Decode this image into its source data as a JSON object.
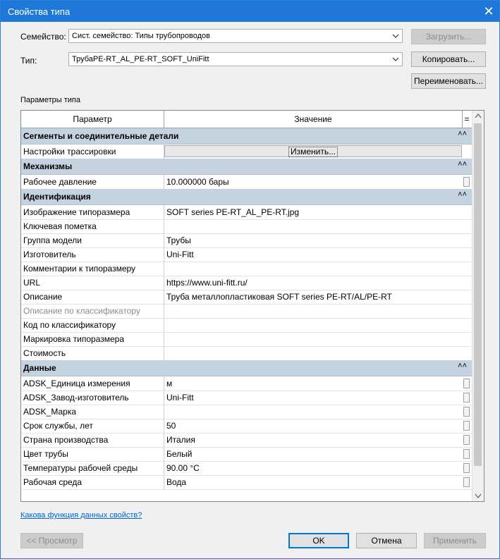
{
  "window": {
    "title": "Свойства типа"
  },
  "family": {
    "label": "Семейство:",
    "value": "Сист. семейство: Типы трубопроводов"
  },
  "type": {
    "label": "Тип:",
    "value": "ТрубаPE-RT_AL_PE-RT_SOFT_UniFitt"
  },
  "buttons": {
    "load": "Загрузить...",
    "copy": "Копировать...",
    "rename": "Переименовать...",
    "preview": "<< Просмотр",
    "ok": "OK",
    "cancel": "Отмена",
    "apply": "Применить"
  },
  "section_label": "Параметры типа",
  "grid": {
    "col_param": "Параметр",
    "col_value": "Значение",
    "col_extra": "=",
    "edit_button": "Изменить...",
    "groups": [
      {
        "title": "Сегменты и соединительные детали",
        "rows": [
          {
            "param": "Настройки трассировки",
            "value": ""
          }
        ]
      },
      {
        "title": "Механизмы",
        "rows": [
          {
            "param": "Рабочее давление",
            "value": "10.000000 бары"
          }
        ]
      },
      {
        "title": "Идентификация",
        "rows": [
          {
            "param": "Изображение типоразмера",
            "value": "SOFT series PE-RT_AL_PE-RT.jpg"
          },
          {
            "param": "Ключевая пометка",
            "value": ""
          },
          {
            "param": "Группа модели",
            "value": "Трубы"
          },
          {
            "param": "Изготовитель",
            "value": "Uni-Fitt"
          },
          {
            "param": "Комментарии к типоразмеру",
            "value": ""
          },
          {
            "param": "URL",
            "value": "https://www.uni-fitt.ru/"
          },
          {
            "param": "Описание",
            "value": "Труба металлопластиковая SOFT series PE-RT/AL/PE-RT"
          },
          {
            "param": "Описание по классификатору",
            "value": ""
          },
          {
            "param": "Код по классификатору",
            "value": ""
          },
          {
            "param": "Маркировка типоразмера",
            "value": ""
          },
          {
            "param": "Стоимость",
            "value": ""
          }
        ]
      },
      {
        "title": "Данные",
        "rows": [
          {
            "param": "ADSK_Единица измерения",
            "value": "м"
          },
          {
            "param": "ADSK_Завод-изготовитель",
            "value": "Uni-Fitt"
          },
          {
            "param": "ADSK_Марка",
            "value": ""
          },
          {
            "param": "Срок службы, лет",
            "value": "50"
          },
          {
            "param": "Страна производства",
            "value": "Италия"
          },
          {
            "param": "Цвет трубы",
            "value": "Белый"
          },
          {
            "param": "Температуры рабочей среды",
            "value": "90.00 °C"
          },
          {
            "param": "Рабочая среда",
            "value": "Вода"
          }
        ]
      }
    ]
  },
  "help_link": "Какова функция данных свойств?",
  "colors": {
    "titlebar": "#1e78d7",
    "group_header": "#c5d2df",
    "link": "#0066cc"
  }
}
